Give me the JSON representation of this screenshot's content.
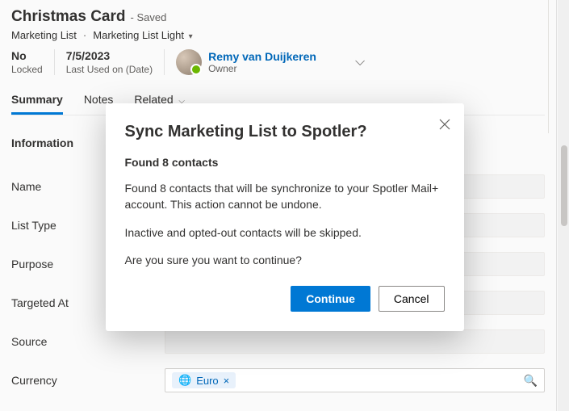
{
  "header": {
    "title": "Christmas Card",
    "saved": "- Saved",
    "entity": "Marketing List",
    "formName": "Marketing List Light",
    "locked": {
      "value": "No",
      "label": "Locked"
    },
    "lastUsed": {
      "value": "7/5/2023",
      "label": "Last Used on (Date)"
    },
    "owner": {
      "name": "Remy van Duijkeren",
      "role": "Owner"
    }
  },
  "tabs": [
    "Summary",
    "Notes",
    "Related"
  ],
  "section": "Information",
  "fields": {
    "name": {
      "label": "Name",
      "value": ""
    },
    "listType": {
      "label": "List Type",
      "value": ""
    },
    "purpose": {
      "label": "Purpose",
      "value": ""
    },
    "targetedAt": {
      "label": "Targeted At",
      "value": ""
    },
    "source": {
      "label": "Source",
      "value": ""
    },
    "currency": {
      "label": "Currency",
      "pill": "Euro"
    }
  },
  "modal": {
    "title": "Sync Marketing List to Spotler?",
    "subtitle": "Found 8 contacts",
    "body1": "Found 8 contacts that will be synchronize to your Spotler Mail+ account. This action cannot be undone.",
    "body2": "Inactive and opted-out contacts will be skipped.",
    "body3": "Are you sure you want to continue?",
    "continue": "Continue",
    "cancel": "Cancel"
  }
}
